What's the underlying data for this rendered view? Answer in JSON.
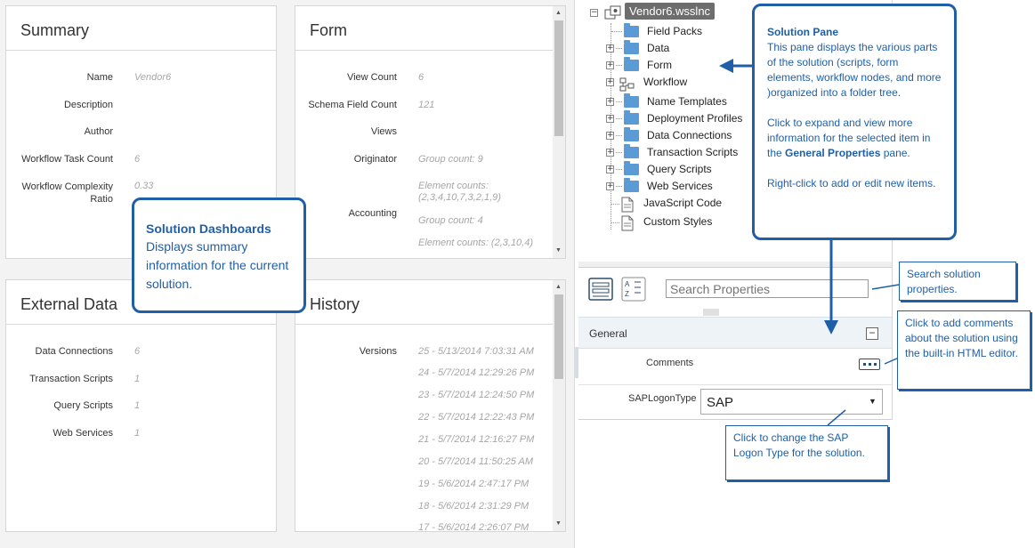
{
  "summary": {
    "title": "Summary",
    "rows": [
      {
        "label": "Name",
        "value": "Vendor6"
      },
      {
        "label": "Description",
        "value": ""
      },
      {
        "label": "Author",
        "value": ""
      },
      {
        "label": "Workflow Task Count",
        "value": "6"
      },
      {
        "label": "Workflow Complexity\nRatio",
        "value": "0.33"
      }
    ]
  },
  "form": {
    "title": "Form",
    "rows": [
      {
        "label": "View Count",
        "value": "6"
      },
      {
        "label": "Schema Field Count",
        "value": "121"
      },
      {
        "label": "Views",
        "value": ""
      },
      {
        "label": "Originator",
        "value": "Group count: 9"
      },
      {
        "label": "",
        "value": "Element counts:\n(2,3,4,10,7,3,2,1,9)"
      },
      {
        "label": "Accounting",
        "value": "Group count: 4"
      },
      {
        "label": "",
        "value": "Element counts: (2,3,10,4)"
      }
    ]
  },
  "external_data": {
    "title": "External Data",
    "rows": [
      {
        "label": "Data Connections",
        "value": "6"
      },
      {
        "label": "Transaction Scripts",
        "value": "1"
      },
      {
        "label": "Query Scripts",
        "value": "1"
      },
      {
        "label": "Web Services",
        "value": "1"
      }
    ]
  },
  "history": {
    "title": "History",
    "label": "Versions",
    "versions": [
      "25 - 5/13/2014 7:03:31 AM",
      "24 - 5/7/2014 12:29:26 PM",
      "23 - 5/7/2014 12:24:50 PM",
      "22 - 5/7/2014 12:22:43 PM",
      "21 - 5/7/2014 12:16:27 PM",
      "20 - 5/7/2014 11:50:25 AM",
      "19 - 5/6/2014 2:47:17 PM",
      "18 - 5/6/2014 2:31:29 PM",
      "17 - 5/6/2014 2:26:07 PM"
    ]
  },
  "tree": {
    "root": "Vendor6.wsslnc",
    "items": [
      {
        "label": "Field Packs",
        "icon": "folder-icon",
        "expandable": false
      },
      {
        "label": "Data",
        "icon": "folder-icon",
        "expandable": true
      },
      {
        "label": "Form",
        "icon": "folder-icon",
        "expandable": true
      },
      {
        "label": "Workflow",
        "icon": "workflow-icon",
        "expandable": true
      },
      {
        "label": "Name Templates",
        "icon": "folder-icon",
        "expandable": true
      },
      {
        "label": "Deployment Profiles",
        "icon": "folder-icon",
        "expandable": true
      },
      {
        "label": "Data Connections",
        "icon": "folder-icon",
        "expandable": true
      },
      {
        "label": "Transaction Scripts",
        "icon": "folder-icon",
        "expandable": true
      },
      {
        "label": "Query Scripts",
        "icon": "folder-icon",
        "expandable": true
      },
      {
        "label": "Web Services",
        "icon": "folder-icon",
        "expandable": true
      },
      {
        "label": "JavaScript Code",
        "icon": "script-file-icon",
        "expandable": false
      },
      {
        "label": "Custom Styles",
        "icon": "script-file-icon",
        "expandable": false
      }
    ]
  },
  "properties": {
    "search_placeholder": "Search Properties",
    "section": "General",
    "comments_label": "Comments",
    "saplogontype_label": "SAPLogonType",
    "saplogontype_value": "SAP"
  },
  "callouts": {
    "dashboards_title": "Solution Dashboards",
    "dashboards_body": "Displays summary information for the current solution.",
    "pane_title": "Solution Pane",
    "pane_p1": "This pane displays the various parts of the solution (scripts, form elements, workflow nodes, and more )organized into a folder tree.",
    "pane_p2_pre": "Click to expand and view more information for the selected item in the ",
    "pane_p2_bold": "General Properties",
    "pane_p2_post": " pane.",
    "pane_p3": "Right-click to add or edit new items.",
    "search": "Search solution properties.",
    "comments": "Click to add comments about the solution using the built-in HTML editor.",
    "sap": "Click to change the SAP Logon Type for the solution."
  },
  "colors": {
    "accent": "#1f5fa8",
    "folder": "#5b9bd5",
    "value_text": "#a6a6a6"
  }
}
